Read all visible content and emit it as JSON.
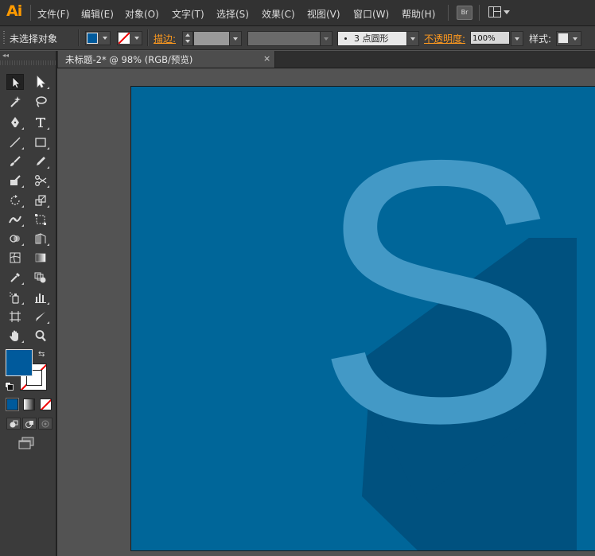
{
  "app": {
    "logo": "Ai",
    "menu": [
      "文件(F)",
      "编辑(E)",
      "对象(O)",
      "文字(T)",
      "选择(S)",
      "效果(C)",
      "视图(V)",
      "窗口(W)",
      "帮助(H)"
    ],
    "bridge_label": "Br"
  },
  "control_bar": {
    "selection_status": "未选择对象",
    "fill_color": "#005a9c",
    "stroke_label": "描边:",
    "brush_points": "3",
    "brush_shape": "点圆形",
    "opacity_label": "不透明度:",
    "opacity_value": "100%",
    "style_label": "样式:"
  },
  "document": {
    "tab_title": "未标题-2* @ 98% (RGB/预览)",
    "close_glyph": "×"
  },
  "tools": [
    {
      "name": "selection-tool",
      "icon": "arrow-icon",
      "active": true
    },
    {
      "name": "direct-selection-tool",
      "icon": "white-arrow-icon"
    },
    {
      "name": "magic-wand-tool",
      "icon": "magic-wand-icon"
    },
    {
      "name": "lasso-tool",
      "icon": "lasso-icon"
    },
    {
      "name": "pen-tool",
      "icon": "pen-icon"
    },
    {
      "name": "type-tool",
      "icon": "type-icon"
    },
    {
      "name": "line-tool",
      "icon": "line-icon"
    },
    {
      "name": "rectangle-tool",
      "icon": "rectangle-icon"
    },
    {
      "name": "paintbrush-tool",
      "icon": "brush-icon"
    },
    {
      "name": "pencil-tool",
      "icon": "pencil-icon"
    },
    {
      "name": "blob-brush-tool",
      "icon": "blob-brush-icon"
    },
    {
      "name": "scissors-tool",
      "icon": "scissors-icon"
    },
    {
      "name": "rotate-tool",
      "icon": "rotate-icon"
    },
    {
      "name": "scale-tool",
      "icon": "scale-icon"
    },
    {
      "name": "width-tool",
      "icon": "width-icon"
    },
    {
      "name": "free-transform-tool",
      "icon": "free-transform-icon"
    },
    {
      "name": "shape-builder-tool",
      "icon": "shape-builder-icon"
    },
    {
      "name": "perspective-grid-tool",
      "icon": "perspective-icon"
    },
    {
      "name": "mesh-tool",
      "icon": "mesh-icon"
    },
    {
      "name": "gradient-tool",
      "icon": "gradient-icon"
    },
    {
      "name": "eyedropper-tool",
      "icon": "eyedropper-icon"
    },
    {
      "name": "blend-tool",
      "icon": "blend-icon"
    },
    {
      "name": "symbol-sprayer-tool",
      "icon": "symbol-sprayer-icon"
    },
    {
      "name": "column-graph-tool",
      "icon": "graph-icon"
    },
    {
      "name": "artboard-tool",
      "icon": "artboard-icon"
    },
    {
      "name": "slice-tool",
      "icon": "slice-icon"
    },
    {
      "name": "hand-tool",
      "icon": "hand-icon"
    },
    {
      "name": "zoom-tool",
      "icon": "zoom-icon"
    }
  ],
  "colors": {
    "accent": "#ff9a1f",
    "artboard_bg": "#006699",
    "letter": "#4399c6",
    "shadow": "#00517f"
  },
  "artwork": {
    "letter": "S"
  }
}
